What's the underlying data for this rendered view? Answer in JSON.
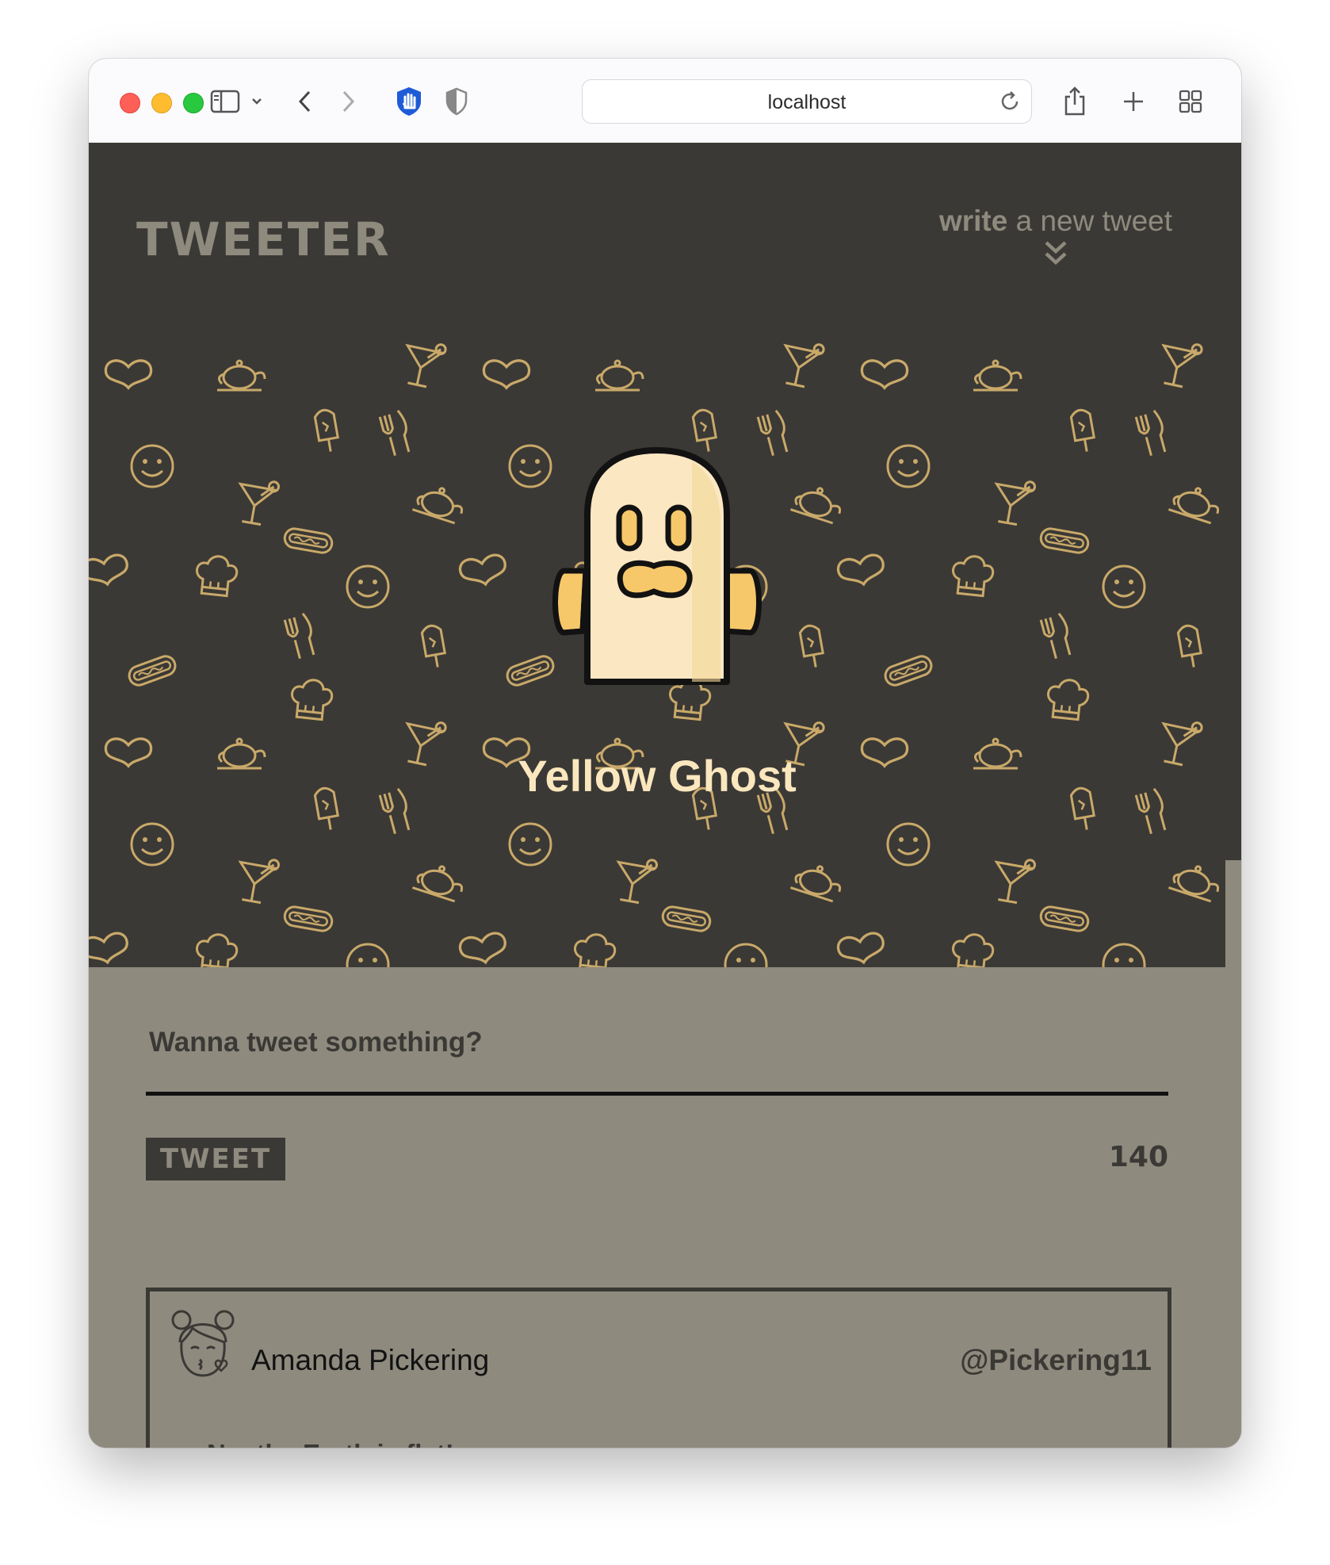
{
  "browser": {
    "url": "localhost",
    "icons": [
      "sidebar-icon",
      "chevron-down-icon",
      "back-icon",
      "forward-icon",
      "hand-shield-icon",
      "privacy-shield-icon",
      "reload-icon",
      "share-icon",
      "new-tab-icon",
      "tab-overview-icon"
    ]
  },
  "header": {
    "brand": "TWEETER",
    "compose_bold": "write",
    "compose_rest": "a new tweet"
  },
  "profile": {
    "name": "Yellow Ghost",
    "avatar_icon": "ghost-icon"
  },
  "composer": {
    "prompt": "Wanna tweet something?",
    "button": "TWEET",
    "counter": "140"
  },
  "tweets": [
    {
      "author": "Amanda Pickering",
      "handle": "@Pickering11",
      "content": "No, the Earth is flat!",
      "avatar_icon": "girl-avatar-icon"
    }
  ],
  "colors": {
    "hero_bg": "#3b3935",
    "page_bg": "#8e8a7e",
    "pattern": "#c9a96a",
    "name": "#fbe7be",
    "ghost_body": "#fbe8c2",
    "ghost_arm": "#f6c869"
  }
}
